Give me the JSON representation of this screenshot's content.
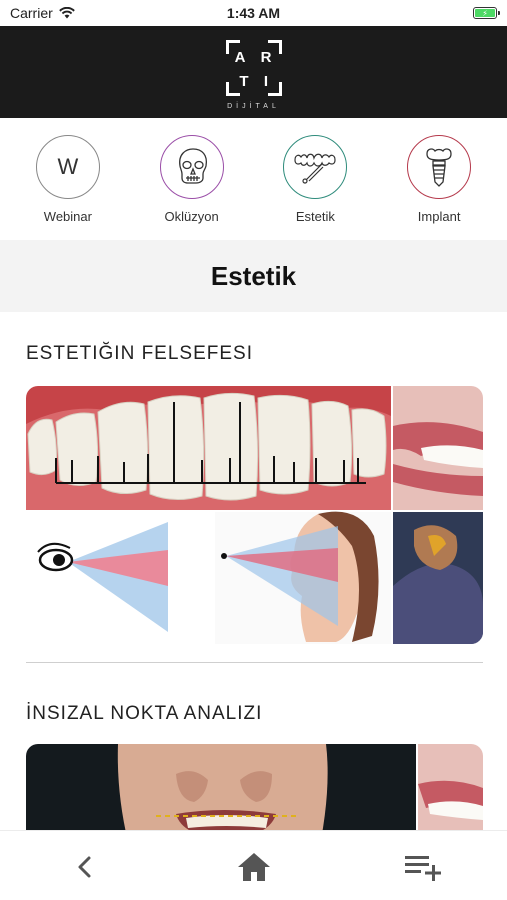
{
  "status_bar": {
    "carrier": "Carrier",
    "time": "1:43 AM",
    "battery_glyph": "⚡"
  },
  "header": {
    "logo_letters": "ARTI",
    "logo_subtitle": "DİJİTAL"
  },
  "categories": [
    {
      "label": "Webinar",
      "icon": "letter-w-icon",
      "letter": "W",
      "color": "#888888"
    },
    {
      "label": "Oklüzyon",
      "icon": "skull-icon",
      "color": "#9b4fa8"
    },
    {
      "label": "Estetik",
      "icon": "teeth-icon",
      "color": "#2f8c7c"
    },
    {
      "label": "Implant",
      "icon": "implant-icon",
      "color": "#b53a4c"
    }
  ],
  "section": {
    "title": "Estetik"
  },
  "articles": [
    {
      "title": "ESTETIĞIN FELSEFESI"
    },
    {
      "title": "İNSIZAL NOKTA ANALIZI"
    }
  ],
  "bottom_nav": {
    "back": "chevron-left-icon",
    "home": "home-icon",
    "add_to_list": "playlist-add-icon"
  }
}
